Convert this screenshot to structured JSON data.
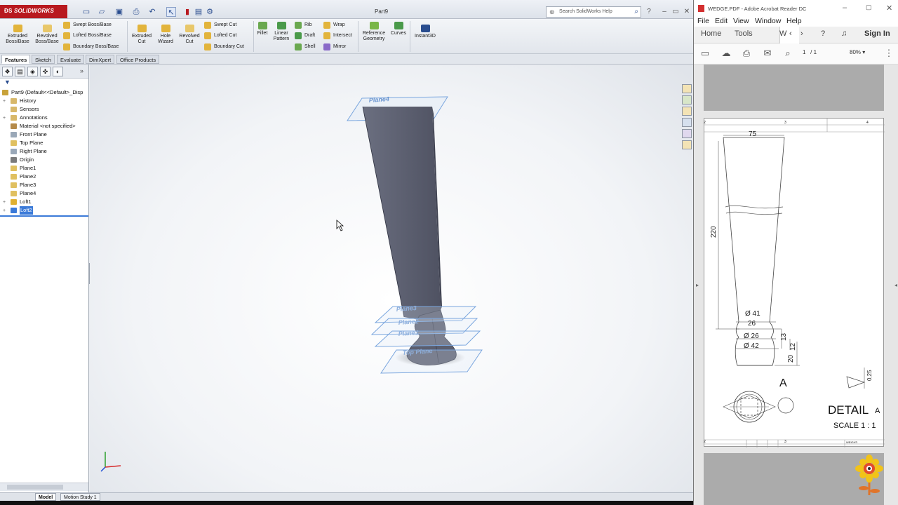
{
  "solidworks": {
    "logo": "SOLIDWORKS",
    "doc_title": "Part9",
    "search_placeholder": "Search SolidWorks Help",
    "commands": {
      "extruded_boss": "Extruded Boss/Base",
      "revolved_boss": "Revolved Boss/Base",
      "swept_boss": "Swept Boss/Base",
      "lofted_boss": "Lofted Boss/Base",
      "boundary_boss": "Boundary Boss/Base",
      "extruded_cut": "Extruded Cut",
      "hole_wizard": "Hole Wizard",
      "revolved_cut": "Revolved Cut",
      "swept_cut": "Swept Cut",
      "lofted_cut": "Lofted Cut",
      "boundary_cut": "Boundary Cut",
      "fillet": "Fillet",
      "linear_pattern": "Linear Pattern",
      "rib": "Rib",
      "draft": "Draft",
      "shell": "Shell",
      "wrap": "Wrap",
      "intersect": "Intersect",
      "mirror": "Mirror",
      "reference_geometry": "Reference Geometry",
      "curves": "Curves",
      "instant3d": "Instant3D"
    },
    "tabs": [
      "Features",
      "Sketch",
      "Evaluate",
      "DimXpert",
      "Office Products"
    ],
    "tree": [
      {
        "label": "Part9  (Default<<Default>_Disp",
        "icon": "part-icon",
        "color": "#c8a23a",
        "expand": "",
        "selected": false
      },
      {
        "label": "History",
        "icon": "history-icon",
        "color": "#d8b86a",
        "expand": "+",
        "selected": false
      },
      {
        "label": "Sensors",
        "icon": "sensors-icon",
        "color": "#d8b86a",
        "expand": "",
        "selected": false
      },
      {
        "label": "Annotations",
        "icon": "annotations-icon",
        "color": "#d8b86a",
        "expand": "+",
        "selected": false
      },
      {
        "label": "Material <not specified>",
        "icon": "material-icon",
        "color": "#b48a4a",
        "expand": "",
        "selected": false
      },
      {
        "label": "Front Plane",
        "icon": "plane-icon",
        "color": "#9aa8b8",
        "expand": "",
        "selected": false
      },
      {
        "label": "Top Plane",
        "icon": "plane-icon",
        "color": "#e0c060",
        "expand": "",
        "selected": false
      },
      {
        "label": "Right Plane",
        "icon": "plane-icon",
        "color": "#9aa8b8",
        "expand": "",
        "selected": false
      },
      {
        "label": "Origin",
        "icon": "origin-icon",
        "color": "#7a7a7a",
        "expand": "",
        "selected": false
      },
      {
        "label": "Plane1",
        "icon": "plane-icon",
        "color": "#e0c060",
        "expand": "",
        "selected": false
      },
      {
        "label": "Plane2",
        "icon": "plane-icon",
        "color": "#e0c060",
        "expand": "",
        "selected": false
      },
      {
        "label": "Plane3",
        "icon": "plane-icon",
        "color": "#e0c060",
        "expand": "",
        "selected": false
      },
      {
        "label": "Plane4",
        "icon": "plane-icon",
        "color": "#e0c060",
        "expand": "",
        "selected": false
      },
      {
        "label": "Loft1",
        "icon": "loft-icon",
        "color": "#e0b030",
        "expand": "+",
        "selected": false
      },
      {
        "label": "Loft2",
        "icon": "loft-icon",
        "color": "#3b7ad8",
        "expand": "+",
        "selected": true
      }
    ],
    "planes": [
      "Plane4",
      "Plane3",
      "Plane2",
      "Plane1",
      "Top Plane"
    ],
    "bottom_tabs": [
      "Model",
      "Motion Study 1"
    ],
    "model_color": "#5d6070"
  },
  "acrobat": {
    "title": "WEDGE.PDF - Adobe Acrobat Reader DC",
    "menu": [
      "File",
      "Edit",
      "View",
      "Window",
      "Help"
    ],
    "nav": {
      "home": "Home",
      "tools": "Tools",
      "active_tab": "W",
      "sign_in": "Sign In"
    },
    "page": "1",
    "page_total": "/ 1",
    "zoom": "80%",
    "drawing": {
      "grid_top": [
        "2",
        "3",
        "4"
      ],
      "dims": {
        "d75": "75",
        "d220": "220",
        "d41": "Ø 41",
        "d26a": "26",
        "d26b": "Ø 26",
        "d42": "Ø 42",
        "d13": "13",
        "d12": "12",
        "d20": "20",
        "d025": "0,25"
      },
      "section_label": "A",
      "detail_title": "DETAIL",
      "detail_letter": "A",
      "scale": "SCALE 1 : 1",
      "weight_label": "WEIGHT:",
      "grid_bottom": [
        "2",
        "3"
      ]
    }
  }
}
